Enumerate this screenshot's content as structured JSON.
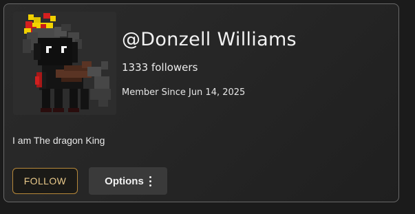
{
  "profile": {
    "username": "@Donzell Williams",
    "followers": "1333 followers",
    "member_since": "Member Since Jun 14, 2025",
    "bio": "I am The dragon King",
    "avatar_icon": "pixel-dragon-avatar-icon"
  },
  "actions": {
    "follow_label": "FOLLOW",
    "options_label": "Options",
    "options_icon": "more-vertical-icon"
  },
  "colors": {
    "follow_accent": "#b8893a",
    "follow_text": "#e9c98a",
    "options_bg": "#3a3a3a"
  }
}
